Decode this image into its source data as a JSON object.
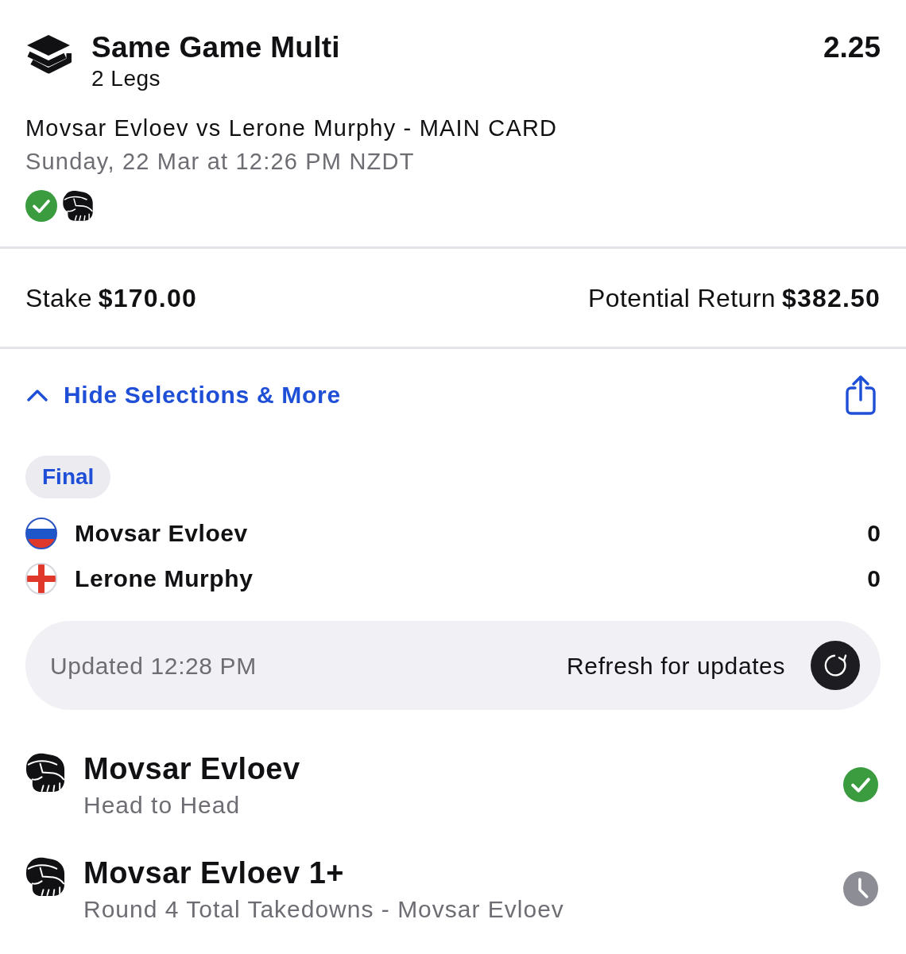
{
  "bet": {
    "title": "Same Game Multi",
    "legs_count": "2 Legs",
    "odds": "2.25",
    "event": "Movsar Evloev vs Lerone Murphy - MAIN CARD",
    "datetime": "Sunday, 22 Mar at 12:26 PM NZDT"
  },
  "stake": {
    "label": "Stake",
    "amount": "$170.00"
  },
  "potential_return": {
    "label": "Potential Return",
    "amount": "$382.50"
  },
  "selections_toggle": {
    "label": "Hide Selections & More",
    "expanded": true
  },
  "scoreboard": {
    "status": "Final",
    "competitors": [
      {
        "name": "Movsar Evloev",
        "score": "0",
        "kind": "russia"
      },
      {
        "name": "Lerone Murphy",
        "score": "0",
        "kind": "england"
      }
    ],
    "updated": "Updated 12:28 PM",
    "refresh_label": "Refresh for updates"
  },
  "legs": [
    {
      "selection": "Movsar Evloev",
      "market": "Head to Head",
      "kind": "won"
    },
    {
      "selection": "Movsar Evloev 1+",
      "market": "Round 4 Total Takedowns - Movsar Evloev",
      "kind": "pending"
    }
  ]
}
